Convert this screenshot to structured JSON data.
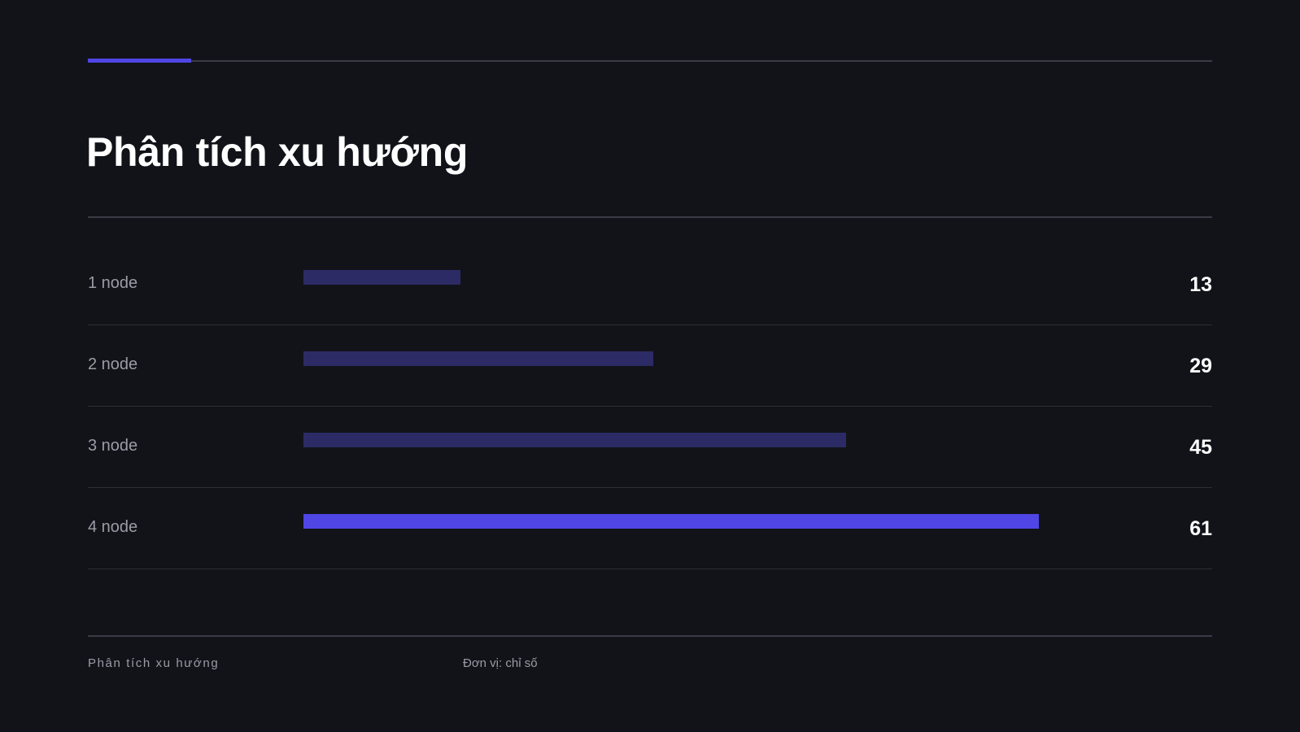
{
  "header": {
    "title": "Phân tích xu hướng"
  },
  "colors": {
    "background": "#121319",
    "accent": "#4f46e5",
    "bar_muted": "#2d2b66",
    "bar_highlight": "#4f46e5"
  },
  "chart_data": {
    "type": "bar",
    "orientation": "horizontal",
    "categories": [
      "1 node",
      "2 node",
      "3 node",
      "4 node"
    ],
    "values": [
      13,
      29,
      45,
      61
    ],
    "highlight_index": 3,
    "xlim": [
      0,
      67.5
    ],
    "grid": false
  },
  "footer": {
    "label": "Phân tích xu hướng",
    "unit": "Đơn vị: chỉ số"
  }
}
